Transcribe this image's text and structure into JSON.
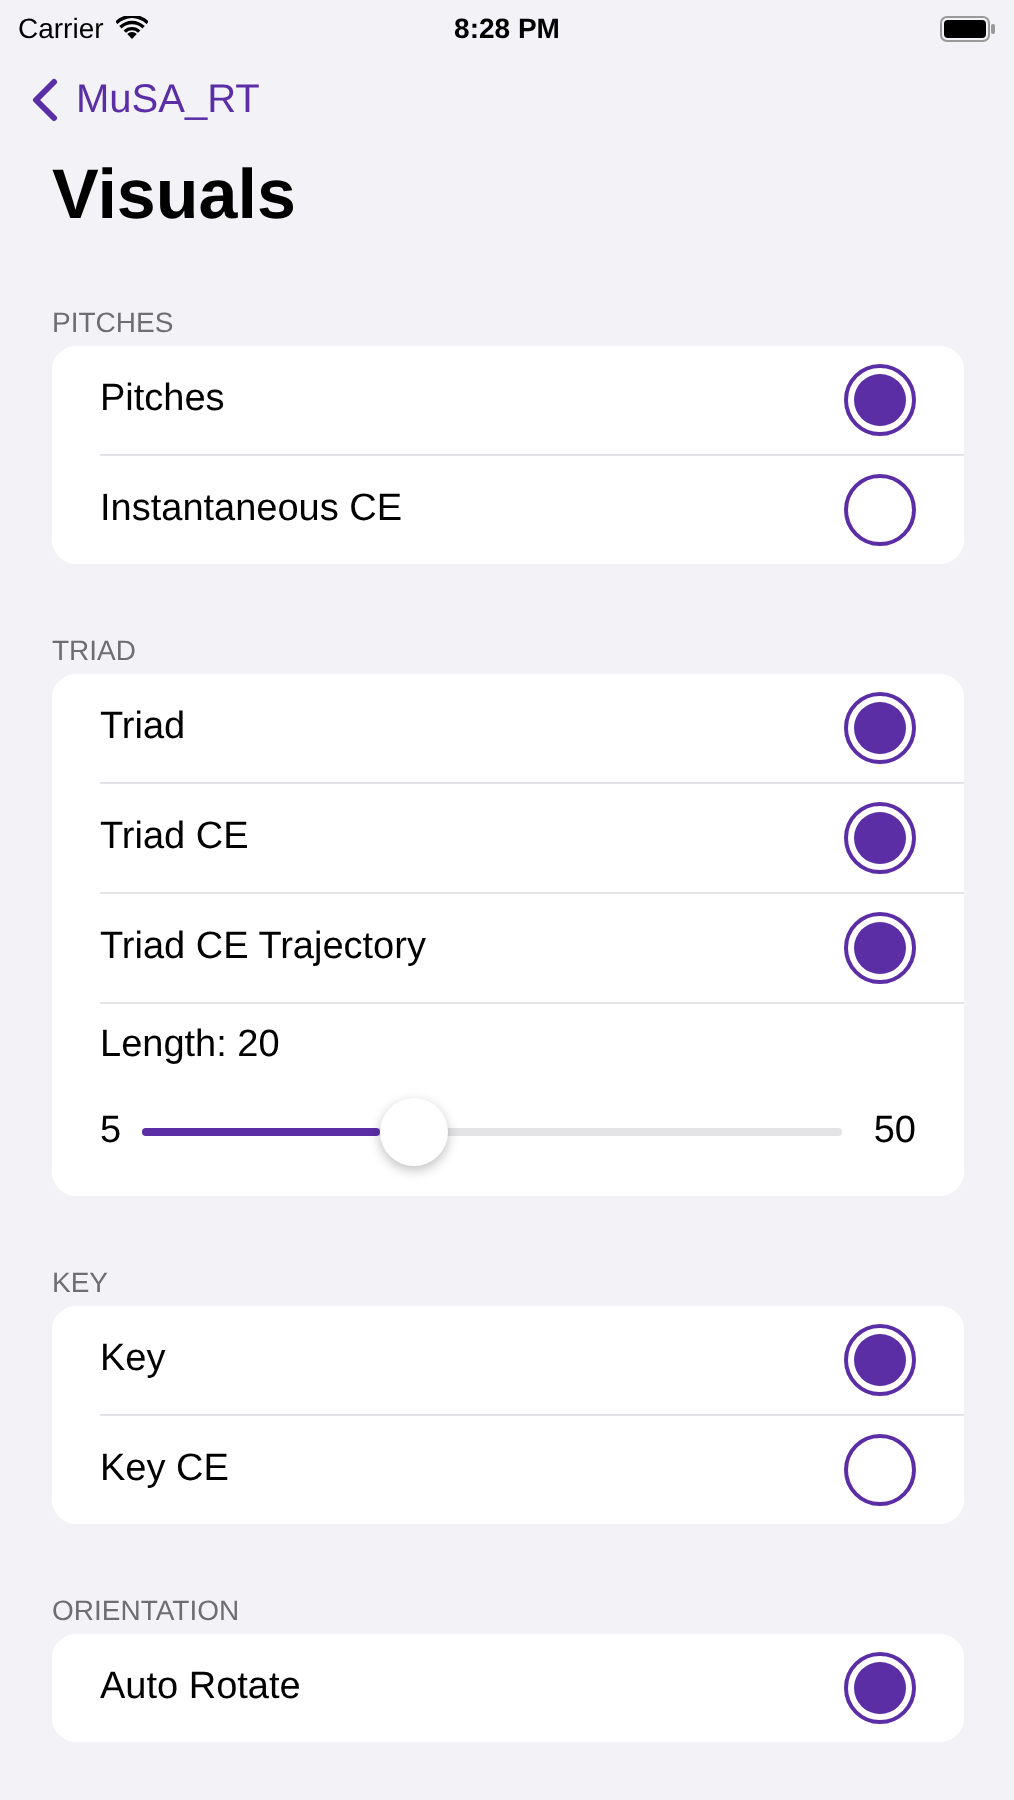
{
  "status_bar": {
    "carrier": "Carrier",
    "time": "8:28 PM"
  },
  "nav": {
    "back_label": "MuSA_RT",
    "title": "Visuals"
  },
  "sections": [
    {
      "header": "PITCHES",
      "rows": [
        {
          "kind": "toggle",
          "label": "Pitches",
          "checked": true
        },
        {
          "kind": "toggle",
          "label": "Instantaneous CE",
          "checked": false
        }
      ]
    },
    {
      "header": "TRIAD",
      "rows": [
        {
          "kind": "toggle",
          "label": "Triad",
          "checked": true
        },
        {
          "kind": "toggle",
          "label": "Triad CE",
          "checked": true
        },
        {
          "kind": "toggle",
          "label": "Triad CE Trajectory",
          "checked": true
        },
        {
          "kind": "slider",
          "label": "Length: 20",
          "min_label": "5",
          "max_label": "50",
          "level": 0.34
        }
      ]
    },
    {
      "header": "KEY",
      "rows": [
        {
          "kind": "toggle",
          "label": "Key",
          "checked": true
        },
        {
          "kind": "toggle",
          "label": "Key CE",
          "checked": false
        }
      ]
    },
    {
      "header": "ORIENTATION",
      "rows": [
        {
          "kind": "toggle",
          "label": "Auto Rotate",
          "checked": true
        }
      ]
    }
  ]
}
